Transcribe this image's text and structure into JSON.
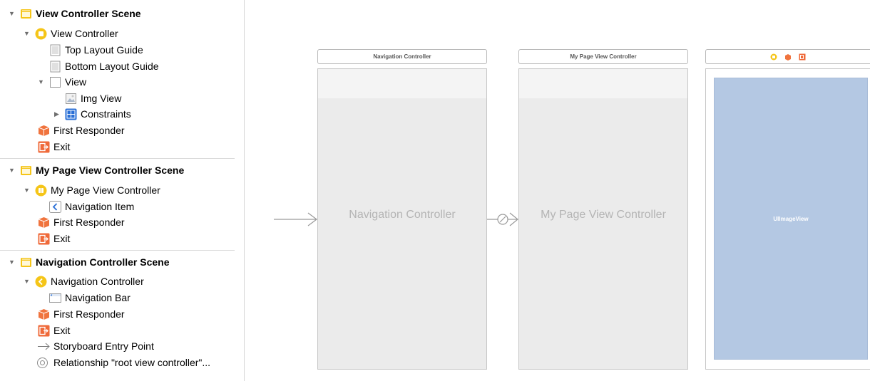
{
  "outline": {
    "scenes": [
      {
        "title": "View Controller Scene",
        "items": {
          "view_controller": "View Controller",
          "top_layout_guide": "Top Layout Guide",
          "bottom_layout_guide": "Bottom Layout Guide",
          "view": "View",
          "img_view": "Img View",
          "constraints": "Constraints",
          "first_responder": "First Responder",
          "exit": "Exit"
        }
      },
      {
        "title": "My Page View Controller Scene",
        "items": {
          "my_page_view_controller": "My Page View Controller",
          "navigation_item": "Navigation Item",
          "first_responder": "First Responder",
          "exit": "Exit"
        }
      },
      {
        "title": "Navigation Controller Scene",
        "items": {
          "navigation_controller": "Navigation Controller",
          "navigation_bar": "Navigation Bar",
          "first_responder": "First Responder",
          "exit": "Exit",
          "storyboard_entry_point": "Storyboard Entry Point",
          "relationship": "Relationship \"root view controller\"..."
        }
      }
    ]
  },
  "canvas": {
    "navigation_controller": {
      "titlebar": "Navigation Controller",
      "center_label": "Navigation Controller"
    },
    "page_view_controller": {
      "titlebar": "My Page View Controller",
      "center_label": "My Page View Controller"
    },
    "view_controller": {
      "image_view_label": "UIImageView"
    }
  },
  "colors": {
    "scene_yellow": "#f5c518",
    "responder_orange": "#f0743e",
    "exit_orange": "#ef6a3a",
    "constraints_blue": "#2a6fd6",
    "image_view_blue": "#b4c8e3"
  }
}
